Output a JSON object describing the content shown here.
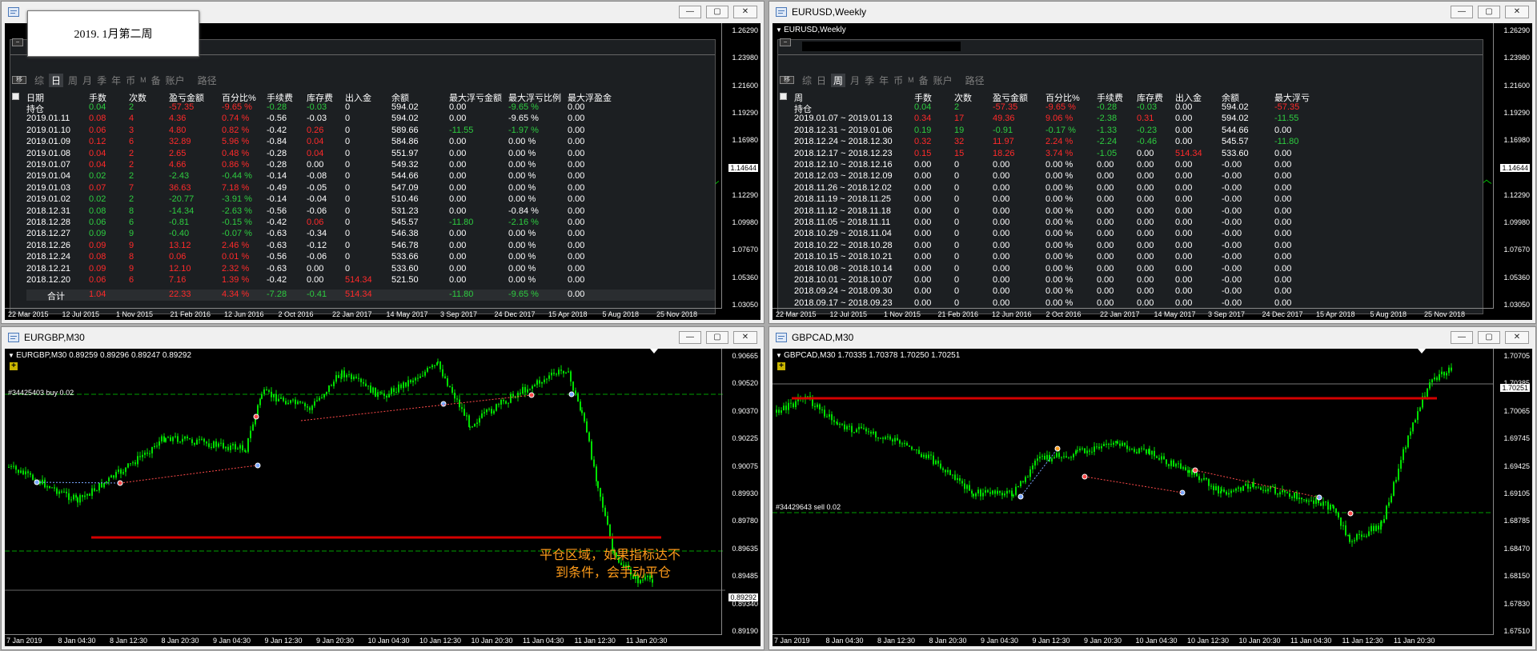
{
  "colors": {
    "bull": "#00e000",
    "bear": "#00e000",
    "grid": "#2f4f2f",
    "profit": "#2ecc40",
    "loss": "#ff2a2a",
    "hline": "#d40000"
  },
  "windows": [
    {
      "id": "w1",
      "title": ""
    },
    {
      "id": "w2",
      "title": "EURUSD,Weekly",
      "symbol": "EURUSD,Weekly"
    },
    {
      "id": "w3",
      "title": "EURGBP,M30",
      "symbol": "EURGBP,M30  0.89259  0.89296  0.89247  0.89292"
    },
    {
      "id": "w4",
      "title": "GBPCAD,M30",
      "symbol": "GBPCAD,M30  1.70335  1.70378  1.70250  1.70251"
    }
  ],
  "overlay_label": "2019. 1月第二周",
  "yaxis_weekly": [
    "1.26290",
    "1.23980",
    "1.21600",
    "1.19290",
    "1.16980",
    "1.14644",
    "1.12290",
    "1.09980",
    "1.07670",
    "1.05360",
    "1.03050"
  ],
  "xaxis_weekly": [
    "22 Mar 2015",
    "12 Jul 2015",
    "1 Nov 2015",
    "21 Feb 2016",
    "12 Jun 2016",
    "2 Oct 2016",
    "22 Jan 2017",
    "14 May 2017",
    "3 Sep 2017",
    "24 Dec 2017",
    "15 Apr 2018",
    "5 Aug 2018",
    "25 Nov 2018"
  ],
  "panel1": {
    "tab_pin": "移",
    "tabs": [
      "综",
      "日",
      "周",
      "月",
      "季",
      "年",
      "币",
      "M",
      "备",
      "账户",
      "路径"
    ],
    "headers": [
      "日期",
      "手数",
      "次数",
      "盈亏金额",
      "百分比%",
      "手续费",
      "库存费",
      "出入金",
      "余额",
      "最大浮亏金额",
      "最大浮亏比例",
      "最大浮盈金"
    ],
    "rows": [
      [
        "持仓",
        "0.04",
        "2",
        "-57.35",
        "-9.65 %",
        "-0.28",
        "-0.03",
        "0",
        "594.02",
        "0.00",
        "-9.65 %",
        "0.00"
      ],
      [
        "2019.01.11",
        "0.08",
        "4",
        "4.36",
        "0.74 %",
        "-0.56",
        "-0.03",
        "0",
        "594.02",
        "0.00",
        "-9.65 %",
        "0.00"
      ],
      [
        "2019.01.10",
        "0.06",
        "3",
        "4.80",
        "0.82 %",
        "-0.42",
        "0.26",
        "0",
        "589.66",
        "-11.55",
        "-1.97 %",
        "0.00"
      ],
      [
        "2019.01.09",
        "0.12",
        "6",
        "32.89",
        "5.96 %",
        "-0.84",
        "0.04",
        "0",
        "584.86",
        "0.00",
        "0.00 %",
        "0.00"
      ],
      [
        "2019.01.08",
        "0.04",
        "2",
        "2.65",
        "0.48 %",
        "-0.28",
        "0.04",
        "0",
        "551.97",
        "0.00",
        "0.00 %",
        "0.00"
      ],
      [
        "2019.01.07",
        "0.04",
        "2",
        "4.66",
        "0.86 %",
        "-0.28",
        "0.00",
        "0",
        "549.32",
        "0.00",
        "0.00 %",
        "0.00"
      ],
      [
        "2019.01.04",
        "0.02",
        "2",
        "-2.43",
        "-0.44 %",
        "-0.14",
        "-0.08",
        "0",
        "544.66",
        "0.00",
        "0.00 %",
        "0.00"
      ],
      [
        "2019.01.03",
        "0.07",
        "7",
        "36.63",
        "7.18 %",
        "-0.49",
        "-0.05",
        "0",
        "547.09",
        "0.00",
        "0.00 %",
        "0.00"
      ],
      [
        "2019.01.02",
        "0.02",
        "2",
        "-20.77",
        "-3.91 %",
        "-0.14",
        "-0.04",
        "0",
        "510.46",
        "0.00",
        "0.00 %",
        "0.00"
      ],
      [
        "2018.12.31",
        "0.08",
        "8",
        "-14.34",
        "-2.63 %",
        "-0.56",
        "-0.06",
        "0",
        "531.23",
        "0.00",
        "-0.84 %",
        "0.00"
      ],
      [
        "2018.12.28",
        "0.06",
        "6",
        "-0.81",
        "-0.15 %",
        "-0.42",
        "0.06",
        "0",
        "545.57",
        "-11.80",
        "-2.16 %",
        "0.00"
      ],
      [
        "2018.12.27",
        "0.09",
        "9",
        "-0.40",
        "-0.07 %",
        "-0.63",
        "-0.34",
        "0",
        "546.38",
        "0.00",
        "0.00 %",
        "0.00"
      ],
      [
        "2018.12.26",
        "0.09",
        "9",
        "13.12",
        "2.46 %",
        "-0.63",
        "-0.12",
        "0",
        "546.78",
        "0.00",
        "0.00 %",
        "0.00"
      ],
      [
        "2018.12.24",
        "0.08",
        "8",
        "0.06",
        "0.01 %",
        "-0.56",
        "-0.06",
        "0",
        "533.66",
        "0.00",
        "0.00 %",
        "0.00"
      ],
      [
        "2018.12.21",
        "0.09",
        "9",
        "12.10",
        "2.32 %",
        "-0.63",
        "0.00",
        "0",
        "533.60",
        "0.00",
        "0.00 %",
        "0.00"
      ],
      [
        "2018.12.20",
        "0.06",
        "6",
        "7.16",
        "1.39 %",
        "-0.42",
        "0.00",
        "514.34",
        "521.50",
        "0.00",
        "0.00 %",
        "0.00"
      ]
    ],
    "row_colors": [
      [
        "w",
        "g",
        "g",
        "r",
        "r",
        "g",
        "g",
        "w",
        "w",
        "w",
        "g",
        "w"
      ],
      [
        "w",
        "r",
        "r",
        "r",
        "r",
        "w",
        "w",
        "w",
        "w",
        "w",
        "w",
        "w"
      ],
      [
        "w",
        "r",
        "r",
        "r",
        "r",
        "w",
        "r",
        "w",
        "w",
        "g",
        "g",
        "w"
      ],
      [
        "w",
        "r",
        "r",
        "r",
        "r",
        "w",
        "r",
        "w",
        "w",
        "w",
        "w",
        "w"
      ],
      [
        "w",
        "r",
        "r",
        "r",
        "r",
        "w",
        "r",
        "w",
        "w",
        "w",
        "w",
        "w"
      ],
      [
        "w",
        "r",
        "r",
        "r",
        "r",
        "w",
        "w",
        "w",
        "w",
        "w",
        "w",
        "w"
      ],
      [
        "w",
        "g",
        "g",
        "g",
        "g",
        "w",
        "w",
        "w",
        "w",
        "w",
        "w",
        "w"
      ],
      [
        "w",
        "r",
        "r",
        "r",
        "r",
        "w",
        "w",
        "w",
        "w",
        "w",
        "w",
        "w"
      ],
      [
        "w",
        "g",
        "g",
        "g",
        "g",
        "w",
        "w",
        "w",
        "w",
        "w",
        "w",
        "w"
      ],
      [
        "w",
        "g",
        "g",
        "g",
        "g",
        "w",
        "w",
        "w",
        "w",
        "w",
        "w",
        "w"
      ],
      [
        "w",
        "g",
        "g",
        "g",
        "g",
        "w",
        "r",
        "w",
        "w",
        "g",
        "g",
        "w"
      ],
      [
        "w",
        "g",
        "g",
        "g",
        "g",
        "w",
        "w",
        "w",
        "w",
        "w",
        "w",
        "w"
      ],
      [
        "w",
        "r",
        "r",
        "r",
        "r",
        "w",
        "w",
        "w",
        "w",
        "w",
        "w",
        "w"
      ],
      [
        "w",
        "r",
        "r",
        "r",
        "r",
        "w",
        "w",
        "w",
        "w",
        "w",
        "w",
        "w"
      ],
      [
        "w",
        "r",
        "r",
        "r",
        "r",
        "w",
        "w",
        "w",
        "w",
        "w",
        "w",
        "w"
      ],
      [
        "w",
        "r",
        "r",
        "r",
        "r",
        "w",
        "w",
        "r",
        "w",
        "w",
        "w",
        "w"
      ]
    ],
    "total": [
      "合计",
      "1.04",
      "",
      "22.33",
      "4.34 %",
      "-7.28",
      "-0.41",
      "514.34",
      "",
      "-11.80",
      "-9.65 %",
      "0.00"
    ],
    "total_colors": [
      "w",
      "r",
      "w",
      "r",
      "r",
      "g",
      "g",
      "r",
      "w",
      "g",
      "g",
      "w"
    ]
  },
  "panel2": {
    "tab_pin": "移",
    "tabs": [
      "综",
      "日",
      "周",
      "月",
      "季",
      "年",
      "币",
      "M",
      "备",
      "账户",
      "路径"
    ],
    "headers": [
      "周",
      "手数",
      "次数",
      "盈亏金额",
      "百分比%",
      "手续费",
      "库存费",
      "出入金",
      "余额",
      "最大浮亏"
    ],
    "rows": [
      [
        "持仓",
        "0.04",
        "2",
        "-57.35",
        "-9.65 %",
        "-0.28",
        "-0.03",
        "0.00",
        "594.02",
        "-57.35"
      ],
      [
        "2019.01.07 ~ 2019.01.13",
        "0.34",
        "17",
        "49.36",
        "9.06 %",
        "-2.38",
        "0.31",
        "0.00",
        "594.02",
        "-11.55"
      ],
      [
        "2018.12.31 ~ 2019.01.06",
        "0.19",
        "19",
        "-0.91",
        "-0.17 %",
        "-1.33",
        "-0.23",
        "0.00",
        "544.66",
        "0.00"
      ],
      [
        "2018.12.24 ~ 2018.12.30",
        "0.32",
        "32",
        "11.97",
        "2.24 %",
        "-2.24",
        "-0.46",
        "0.00",
        "545.57",
        "-11.80"
      ],
      [
        "2018.12.17 ~ 2018.12.23",
        "0.15",
        "15",
        "18.26",
        "3.74 %",
        "-1.05",
        "0.00",
        "514.34",
        "533.60",
        "0.00"
      ],
      [
        "2018.12.10 ~ 2018.12.16",
        "0.00",
        "0",
        "0.00",
        "0.00 %",
        "0.00",
        "0.00",
        "0.00",
        "-0.00",
        "0.00"
      ],
      [
        "2018.12.03 ~ 2018.12.09",
        "0.00",
        "0",
        "0.00",
        "0.00 %",
        "0.00",
        "0.00",
        "0.00",
        "-0.00",
        "0.00"
      ],
      [
        "2018.11.26 ~ 2018.12.02",
        "0.00",
        "0",
        "0.00",
        "0.00 %",
        "0.00",
        "0.00",
        "0.00",
        "-0.00",
        "0.00"
      ],
      [
        "2018.11.19 ~ 2018.11.25",
        "0.00",
        "0",
        "0.00",
        "0.00 %",
        "0.00",
        "0.00",
        "0.00",
        "-0.00",
        "0.00"
      ],
      [
        "2018.11.12 ~ 2018.11.18",
        "0.00",
        "0",
        "0.00",
        "0.00 %",
        "0.00",
        "0.00",
        "0.00",
        "-0.00",
        "0.00"
      ],
      [
        "2018.11.05 ~ 2018.11.11",
        "0.00",
        "0",
        "0.00",
        "0.00 %",
        "0.00",
        "0.00",
        "0.00",
        "-0.00",
        "0.00"
      ],
      [
        "2018.10.29 ~ 2018.11.04",
        "0.00",
        "0",
        "0.00",
        "0.00 %",
        "0.00",
        "0.00",
        "0.00",
        "-0.00",
        "0.00"
      ],
      [
        "2018.10.22 ~ 2018.10.28",
        "0.00",
        "0",
        "0.00",
        "0.00 %",
        "0.00",
        "0.00",
        "0.00",
        "-0.00",
        "0.00"
      ],
      [
        "2018.10.15 ~ 2018.10.21",
        "0.00",
        "0",
        "0.00",
        "0.00 %",
        "0.00",
        "0.00",
        "0.00",
        "-0.00",
        "0.00"
      ],
      [
        "2018.10.08 ~ 2018.10.14",
        "0.00",
        "0",
        "0.00",
        "0.00 %",
        "0.00",
        "0.00",
        "0.00",
        "-0.00",
        "0.00"
      ],
      [
        "2018.10.01 ~ 2018.10.07",
        "0.00",
        "0",
        "0.00",
        "0.00 %",
        "0.00",
        "0.00",
        "0.00",
        "-0.00",
        "0.00"
      ],
      [
        "2018.09.24 ~ 2018.09.30",
        "0.00",
        "0",
        "0.00",
        "0.00 %",
        "0.00",
        "0.00",
        "0.00",
        "-0.00",
        "0.00"
      ],
      [
        "2018.09.17 ~ 2018.09.23",
        "0.00",
        "0",
        "0.00",
        "0.00 %",
        "0.00",
        "0.00",
        "0.00",
        "-0.00",
        "0.00"
      ]
    ],
    "row_colors": [
      [
        "w",
        "g",
        "g",
        "r",
        "r",
        "g",
        "g",
        "w",
        "w",
        "r"
      ],
      [
        "w",
        "r",
        "r",
        "r",
        "r",
        "g",
        "r",
        "w",
        "w",
        "g"
      ],
      [
        "w",
        "g",
        "g",
        "g",
        "g",
        "g",
        "g",
        "w",
        "w",
        "w"
      ],
      [
        "w",
        "r",
        "r",
        "r",
        "r",
        "g",
        "g",
        "w",
        "w",
        "g"
      ],
      [
        "w",
        "r",
        "r",
        "r",
        "r",
        "g",
        "w",
        "r",
        "w",
        "w"
      ],
      [
        "w",
        "w",
        "w",
        "w",
        "w",
        "w",
        "w",
        "w",
        "w",
        "w"
      ],
      [
        "w",
        "w",
        "w",
        "w",
        "w",
        "w",
        "w",
        "w",
        "w",
        "w"
      ],
      [
        "w",
        "w",
        "w",
        "w",
        "w",
        "w",
        "w",
        "w",
        "w",
        "w"
      ],
      [
        "w",
        "w",
        "w",
        "w",
        "w",
        "w",
        "w",
        "w",
        "w",
        "w"
      ],
      [
        "w",
        "w",
        "w",
        "w",
        "w",
        "w",
        "w",
        "w",
        "w",
        "w"
      ],
      [
        "w",
        "w",
        "w",
        "w",
        "w",
        "w",
        "w",
        "w",
        "w",
        "w"
      ],
      [
        "w",
        "w",
        "w",
        "w",
        "w",
        "w",
        "w",
        "w",
        "w",
        "w"
      ],
      [
        "w",
        "w",
        "w",
        "w",
        "w",
        "w",
        "w",
        "w",
        "w",
        "w"
      ],
      [
        "w",
        "w",
        "w",
        "w",
        "w",
        "w",
        "w",
        "w",
        "w",
        "w"
      ],
      [
        "w",
        "w",
        "w",
        "w",
        "w",
        "w",
        "w",
        "w",
        "w",
        "w"
      ],
      [
        "w",
        "w",
        "w",
        "w",
        "w",
        "w",
        "w",
        "w",
        "w",
        "w"
      ],
      [
        "w",
        "w",
        "w",
        "w",
        "w",
        "w",
        "w",
        "w",
        "w",
        "w"
      ],
      [
        "w",
        "w",
        "w",
        "w",
        "w",
        "w",
        "w",
        "w",
        "w",
        "w"
      ]
    ]
  },
  "eurgbp": {
    "yaxis": [
      "0.90665",
      "0.90520",
      "0.90370",
      "0.90225",
      "0.90075",
      "0.89930",
      "0.89780",
      "0.89635",
      "0.89485",
      "0.89340",
      "0.89190"
    ],
    "price_tag": "0.89292",
    "xaxis": [
      "7 Jan 2019",
      "8 Jan 04:30",
      "8 Jan 12:30",
      "8 Jan 20:30",
      "9 Jan 04:30",
      "9 Jan 12:30",
      "9 Jan 20:30",
      "10 Jan 04:30",
      "10 Jan 12:30",
      "10 Jan 20:30",
      "11 Jan 04:30",
      "11 Jan 12:30",
      "11 Jan 20:30"
    ],
    "order_label": "#34425403 buy 0.02",
    "annotation": [
      "平仓区域，如果指标达不",
      "到条件，会手动平仓"
    ]
  },
  "gbpcad": {
    "yaxis": [
      "1.70705",
      "1.70385",
      "1.70065",
      "1.69745",
      "1.69425",
      "1.69105",
      "1.68785",
      "1.68470",
      "1.68150",
      "1.67830",
      "1.67510"
    ],
    "price_tag": "1.70251",
    "xaxis": [
      "7 Jan 2019",
      "8 Jan 04:30",
      "8 Jan 12:30",
      "8 Jan 20:30",
      "9 Jan 04:30",
      "9 Jan 12:30",
      "9 Jan 20:30",
      "10 Jan 04:30",
      "10 Jan 12:30",
      "10 Jan 20:30",
      "11 Jan 04:30",
      "11 Jan 12:30",
      "11 Jan 20:30"
    ],
    "order_label": "#34429643 sell 0.02"
  }
}
